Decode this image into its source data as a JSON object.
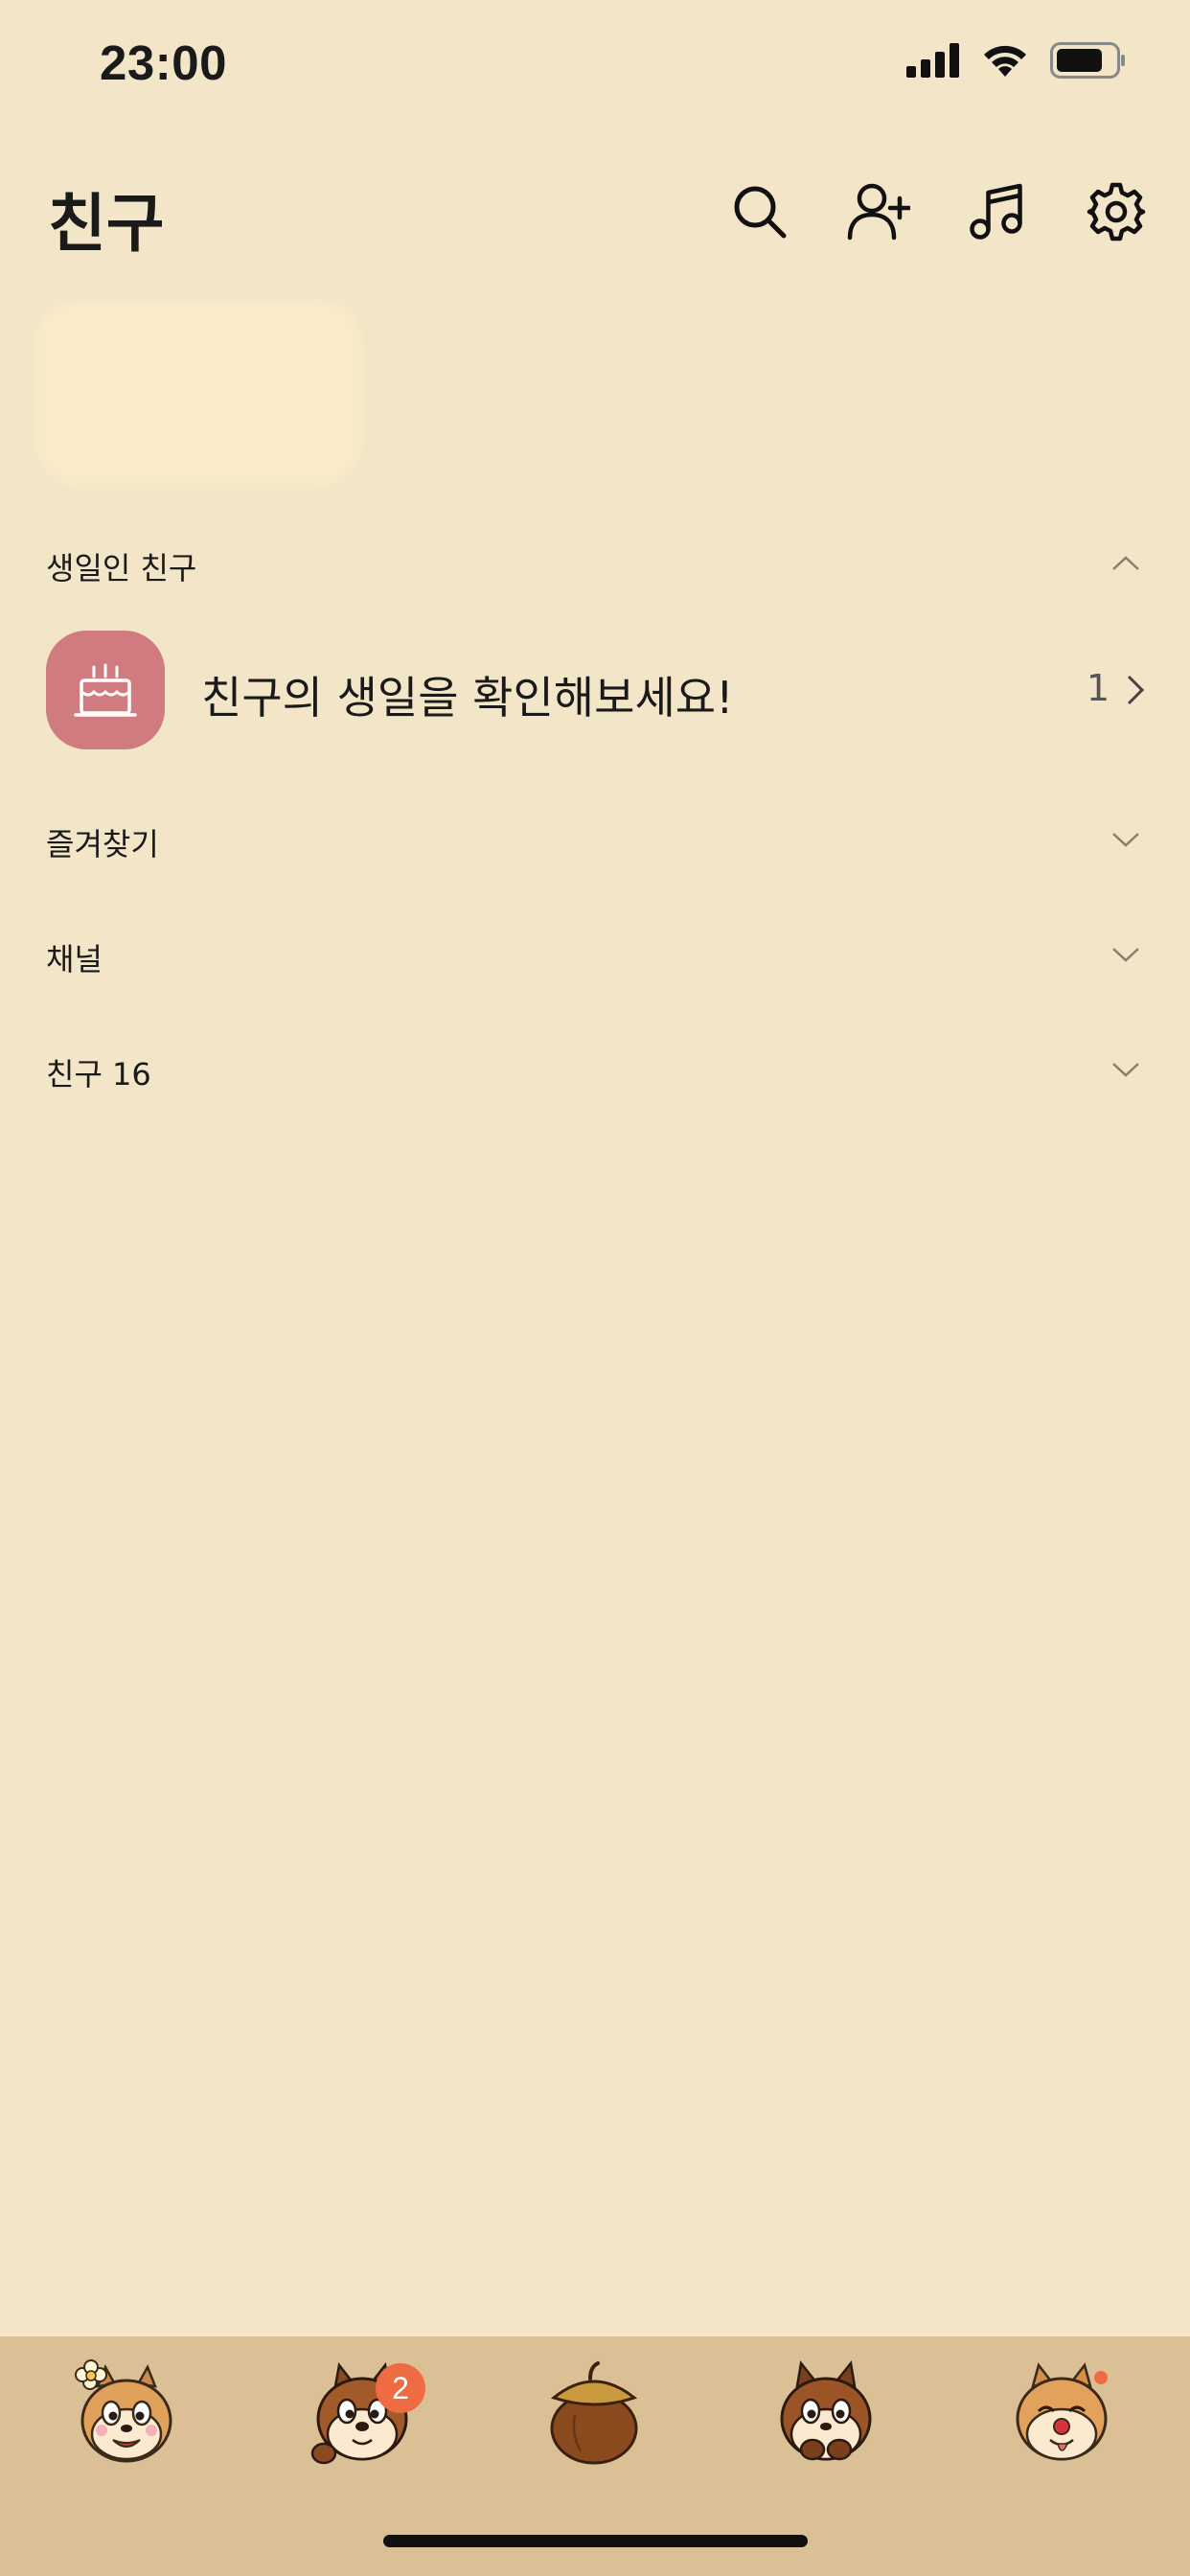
{
  "status_bar": {
    "time": "23:00"
  },
  "header": {
    "title": "친구"
  },
  "sections": {
    "birthday": {
      "label": "생일인 친구"
    },
    "favorites": {
      "label": "즐겨찾기"
    },
    "channels": {
      "label": "채널"
    },
    "friends": {
      "label": "친구 16"
    }
  },
  "birthday_banner": {
    "text": "친구의 생일을 확인해보세요!",
    "count": "1"
  },
  "bottom_tabs": {
    "chat_badge": "2"
  },
  "icons": {
    "header": [
      "search-icon",
      "add-friend-icon",
      "music-icon",
      "settings-icon"
    ],
    "tabs": [
      "friends-tab-icon",
      "chat-tab-icon",
      "view-tab-icon",
      "shopping-tab-icon",
      "more-tab-icon"
    ]
  },
  "colors": {
    "background": "#F3E6C8",
    "tab_bar": "#DBBF95",
    "birthday_icon_bg": "#D07B7F",
    "badge": "#EE6B43"
  }
}
